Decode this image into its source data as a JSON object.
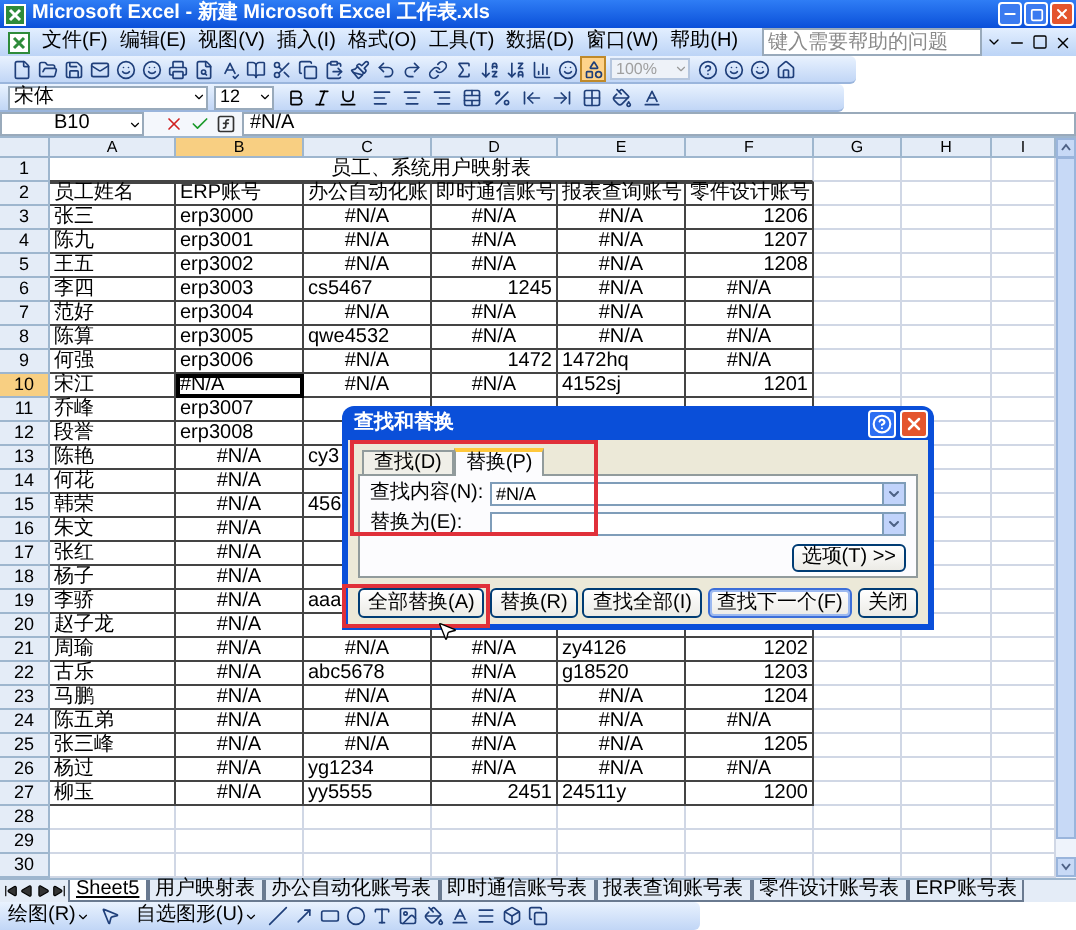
{
  "window": {
    "title": "Microsoft Excel - 新建 Microsoft Excel 工作表.xls"
  },
  "menu": [
    "文件(F)",
    "编辑(E)",
    "视图(V)",
    "插入(I)",
    "格式(O)",
    "工具(T)",
    "数据(D)",
    "窗口(W)",
    "帮助(H)"
  ],
  "help_box": {
    "placeholder": "键入需要帮助的问题"
  },
  "toolbar": {
    "drawing_on": true,
    "zoom": {
      "value": "100%",
      "disabled": true
    },
    "font": "宋体",
    "font_size": "12"
  },
  "formula_bar": {
    "name_box": "B10",
    "value": "#N/A"
  },
  "columns": [
    {
      "label": "A",
      "selected": false
    },
    {
      "label": "B",
      "selected": true
    },
    {
      "label": "C",
      "selected": false
    },
    {
      "label": "D",
      "selected": false
    },
    {
      "label": "E",
      "selected": false
    },
    {
      "label": "F",
      "selected": false
    },
    {
      "label": "G",
      "selected": false
    },
    {
      "label": "H",
      "selected": false
    },
    {
      "label": "I",
      "selected": false
    }
  ],
  "rows": [
    {
      "label": "1",
      "selected": false,
      "bordered": false,
      "cells": [
        {
          "text": "员工、系统用户映射表",
          "kind": "title"
        }
      ]
    },
    {
      "label": "2",
      "selected": false,
      "bordered": true,
      "cells": [
        {
          "text": "员工姓名",
          "kind": "text"
        },
        {
          "text": "ERP账号",
          "kind": "text"
        },
        {
          "text": "办公自动化账",
          "kind": "text"
        },
        {
          "text": "即时通信账号",
          "kind": "text"
        },
        {
          "text": "报表查询账号",
          "kind": "text"
        },
        {
          "text": "零件设计账号",
          "kind": "text"
        }
      ]
    },
    {
      "label": "3",
      "selected": false,
      "bordered": true,
      "cells": [
        {
          "text": "张三",
          "kind": "text"
        },
        {
          "text": "erp3000",
          "kind": "text"
        },
        {
          "text": "#N/A",
          "kind": "error"
        },
        {
          "text": "#N/A",
          "kind": "error"
        },
        {
          "text": "#N/A",
          "kind": "error"
        },
        {
          "text": "1206",
          "kind": "number"
        }
      ]
    },
    {
      "label": "4",
      "selected": false,
      "bordered": true,
      "cells": [
        {
          "text": "陈九",
          "kind": "text"
        },
        {
          "text": "erp3001",
          "kind": "text"
        },
        {
          "text": "#N/A",
          "kind": "error"
        },
        {
          "text": "#N/A",
          "kind": "error"
        },
        {
          "text": "#N/A",
          "kind": "error"
        },
        {
          "text": "1207",
          "kind": "number"
        }
      ]
    },
    {
      "label": "5",
      "selected": false,
      "bordered": true,
      "cells": [
        {
          "text": "王五",
          "kind": "text"
        },
        {
          "text": "erp3002",
          "kind": "text"
        },
        {
          "text": "#N/A",
          "kind": "error"
        },
        {
          "text": "#N/A",
          "kind": "error"
        },
        {
          "text": "#N/A",
          "kind": "error"
        },
        {
          "text": "1208",
          "kind": "number"
        }
      ]
    },
    {
      "label": "6",
      "selected": false,
      "bordered": true,
      "cells": [
        {
          "text": "李四",
          "kind": "text"
        },
        {
          "text": "erp3003",
          "kind": "text"
        },
        {
          "text": "cs5467",
          "kind": "text"
        },
        {
          "text": "1245",
          "kind": "number"
        },
        {
          "text": "#N/A",
          "kind": "error"
        },
        {
          "text": "#N/A",
          "kind": "error"
        }
      ]
    },
    {
      "label": "7",
      "selected": false,
      "bordered": true,
      "cells": [
        {
          "text": "范好",
          "kind": "text"
        },
        {
          "text": "erp3004",
          "kind": "text"
        },
        {
          "text": "#N/A",
          "kind": "error"
        },
        {
          "text": "#N/A",
          "kind": "error"
        },
        {
          "text": "#N/A",
          "kind": "error"
        },
        {
          "text": "#N/A",
          "kind": "error"
        }
      ]
    },
    {
      "label": "8",
      "selected": false,
      "bordered": true,
      "cells": [
        {
          "text": "陈算",
          "kind": "text"
        },
        {
          "text": "erp3005",
          "kind": "text"
        },
        {
          "text": "qwe4532",
          "kind": "text"
        },
        {
          "text": "#N/A",
          "kind": "error"
        },
        {
          "text": "#N/A",
          "kind": "error"
        },
        {
          "text": "#N/A",
          "kind": "error"
        }
      ]
    },
    {
      "label": "9",
      "selected": false,
      "bordered": true,
      "cells": [
        {
          "text": "何强",
          "kind": "text"
        },
        {
          "text": "erp3006",
          "kind": "text"
        },
        {
          "text": "#N/A",
          "kind": "error"
        },
        {
          "text": "1472",
          "kind": "number"
        },
        {
          "text": "1472hq",
          "kind": "text"
        },
        {
          "text": "#N/A",
          "kind": "error"
        }
      ]
    },
    {
      "label": "10",
      "selected": true,
      "bordered": true,
      "cells": [
        {
          "text": "宋江",
          "kind": "text"
        },
        {
          "text": "#N/A",
          "kind": "text"
        },
        {
          "text": "#N/A",
          "kind": "error"
        },
        {
          "text": "#N/A",
          "kind": "error"
        },
        {
          "text": "4152sj",
          "kind": "text"
        },
        {
          "text": "1201",
          "kind": "number"
        }
      ]
    },
    {
      "label": "11",
      "selected": false,
      "bordered": true,
      "cells": [
        {
          "text": "乔峰",
          "kind": "text"
        },
        {
          "text": "erp3007",
          "kind": "text"
        }
      ]
    },
    {
      "label": "12",
      "selected": false,
      "bordered": true,
      "cells": [
        {
          "text": "段誉",
          "kind": "text"
        },
        {
          "text": "erp3008",
          "kind": "text"
        }
      ]
    },
    {
      "label": "13",
      "selected": false,
      "bordered": true,
      "cells": [
        {
          "text": "陈艳",
          "kind": "text"
        },
        {
          "text": "#N/A",
          "kind": "error"
        },
        {
          "text": "cy3",
          "kind": "text"
        }
      ]
    },
    {
      "label": "14",
      "selected": false,
      "bordered": true,
      "cells": [
        {
          "text": "何花",
          "kind": "text"
        },
        {
          "text": "#N/A",
          "kind": "error"
        }
      ]
    },
    {
      "label": "15",
      "selected": false,
      "bordered": true,
      "cells": [
        {
          "text": "韩荣",
          "kind": "text"
        },
        {
          "text": "#N/A",
          "kind": "error"
        },
        {
          "text": "456",
          "kind": "text"
        }
      ]
    },
    {
      "label": "16",
      "selected": false,
      "bordered": true,
      "cells": [
        {
          "text": "朱文",
          "kind": "text"
        },
        {
          "text": "#N/A",
          "kind": "error"
        }
      ]
    },
    {
      "label": "17",
      "selected": false,
      "bordered": true,
      "cells": [
        {
          "text": "张红",
          "kind": "text"
        },
        {
          "text": "#N/A",
          "kind": "error"
        }
      ]
    },
    {
      "label": "18",
      "selected": false,
      "bordered": true,
      "cells": [
        {
          "text": "杨子",
          "kind": "text"
        },
        {
          "text": "#N/A",
          "kind": "error"
        }
      ]
    },
    {
      "label": "19",
      "selected": false,
      "bordered": true,
      "cells": [
        {
          "text": "李骄",
          "kind": "text"
        },
        {
          "text": "#N/A",
          "kind": "error"
        },
        {
          "text": "aaa",
          "kind": "text"
        }
      ]
    },
    {
      "label": "20",
      "selected": false,
      "bordered": true,
      "cells": [
        {
          "text": "赵子龙",
          "kind": "text"
        },
        {
          "text": "#N/A",
          "kind": "error"
        }
      ]
    },
    {
      "label": "21",
      "selected": false,
      "bordered": true,
      "cells": [
        {
          "text": "周瑜",
          "kind": "text"
        },
        {
          "text": "#N/A",
          "kind": "error"
        },
        {
          "text": "#N/A",
          "kind": "error"
        },
        {
          "text": "#N/A",
          "kind": "error"
        },
        {
          "text": "zy4126",
          "kind": "text"
        },
        {
          "text": "1202",
          "kind": "number"
        }
      ]
    },
    {
      "label": "22",
      "selected": false,
      "bordered": true,
      "cells": [
        {
          "text": "古乐",
          "kind": "text"
        },
        {
          "text": "#N/A",
          "kind": "error"
        },
        {
          "text": "abc5678",
          "kind": "text"
        },
        {
          "text": "#N/A",
          "kind": "error"
        },
        {
          "text": "g18520",
          "kind": "text"
        },
        {
          "text": "1203",
          "kind": "number"
        }
      ]
    },
    {
      "label": "23",
      "selected": false,
      "bordered": true,
      "cells": [
        {
          "text": "马鹏",
          "kind": "text"
        },
        {
          "text": "#N/A",
          "kind": "error"
        },
        {
          "text": "#N/A",
          "kind": "error"
        },
        {
          "text": "#N/A",
          "kind": "error"
        },
        {
          "text": "#N/A",
          "kind": "error"
        },
        {
          "text": "1204",
          "kind": "number"
        }
      ]
    },
    {
      "label": "24",
      "selected": false,
      "bordered": true,
      "cells": [
        {
          "text": "陈五弟",
          "kind": "text"
        },
        {
          "text": "#N/A",
          "kind": "error"
        },
        {
          "text": "#N/A",
          "kind": "error"
        },
        {
          "text": "#N/A",
          "kind": "error"
        },
        {
          "text": "#N/A",
          "kind": "error"
        },
        {
          "text": "#N/A",
          "kind": "error"
        }
      ]
    },
    {
      "label": "25",
      "selected": false,
      "bordered": true,
      "cells": [
        {
          "text": "张三峰",
          "kind": "text"
        },
        {
          "text": "#N/A",
          "kind": "error"
        },
        {
          "text": "#N/A",
          "kind": "error"
        },
        {
          "text": "#N/A",
          "kind": "error"
        },
        {
          "text": "#N/A",
          "kind": "error"
        },
        {
          "text": "1205",
          "kind": "number"
        }
      ]
    },
    {
      "label": "26",
      "selected": false,
      "bordered": true,
      "cells": [
        {
          "text": "杨过",
          "kind": "text"
        },
        {
          "text": "#N/A",
          "kind": "error"
        },
        {
          "text": "yg1234",
          "kind": "text"
        },
        {
          "text": "#N/A",
          "kind": "error"
        },
        {
          "text": "#N/A",
          "kind": "error"
        },
        {
          "text": "#N/A",
          "kind": "error"
        }
      ]
    },
    {
      "label": "27",
      "selected": false,
      "bordered": true,
      "cells": [
        {
          "text": "柳玉",
          "kind": "text"
        },
        {
          "text": "#N/A",
          "kind": "error"
        },
        {
          "text": "yy5555",
          "kind": "text"
        },
        {
          "text": "2451",
          "kind": "number"
        },
        {
          "text": "24511y",
          "kind": "text"
        },
        {
          "text": "1200",
          "kind": "number"
        }
      ]
    },
    {
      "label": "28",
      "selected": false,
      "bordered": false
    },
    {
      "label": "29",
      "selected": false,
      "bordered": false
    },
    {
      "label": "30",
      "selected": false,
      "bordered": false
    }
  ],
  "dialog": {
    "title": "查找和替换",
    "tabs": [
      {
        "label": "查找(D)",
        "selected": false
      },
      {
        "label": "替换(P)",
        "selected": true
      }
    ],
    "find": {
      "label": "查找内容(N):",
      "value": "#N/A"
    },
    "replace": {
      "label": "替换为(E):"
    },
    "options_button": "选项(T) >>",
    "buttons": [
      {
        "label": "全部替换(A)",
        "default": false
      },
      {
        "label": "替换(R)",
        "default": false
      },
      {
        "label": "查找全部(I)",
        "default": false
      },
      {
        "label": "查找下一个(F)",
        "default": true
      },
      {
        "label": "关闭",
        "default": false
      }
    ]
  },
  "sheet_tabs": [
    {
      "label": "Sheet5",
      "selected": true
    },
    {
      "label": "用户映射表",
      "selected": false
    },
    {
      "label": "办公自动化账号表",
      "selected": false
    },
    {
      "label": "即时通信账号表",
      "selected": false
    },
    {
      "label": "报表查询账号表",
      "selected": false
    },
    {
      "label": "零件设计账号表",
      "selected": false
    },
    {
      "label": "ERP账号表",
      "selected": false
    }
  ],
  "drawing_toolbar": {
    "draw_menu": "绘图(R)",
    "autoshapes_menu": "自选图形(U)"
  }
}
